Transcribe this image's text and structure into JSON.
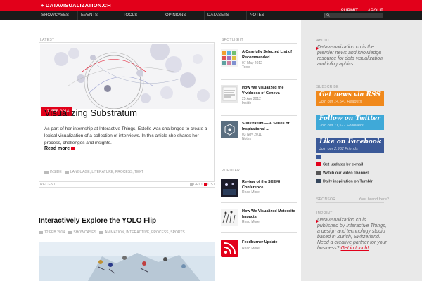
{
  "header": {
    "logo": "+ DATAVISUALIZATION.CH",
    "links": [
      "SUBMIT",
      "ABOUT"
    ]
  },
  "nav": {
    "items": [
      "SHOWCASES",
      "EVENTS",
      "TOOLS",
      "OPINIONS",
      "DATASETS",
      "NOTES"
    ]
  },
  "labels": {
    "latest": "LATEST",
    "spotlight": "SPOTLIGHT",
    "popular": "POPULAR",
    "recent": "RECENT",
    "about": "ABOUT",
    "subscribe": "SUBSCRIBE",
    "sponsor": "SPONSOR",
    "sponsor_link": "Your brand here?",
    "imprint": "IMPRINT"
  },
  "latest": {
    "date": "17 FEB 2014",
    "title": "Visualizing Substratum",
    "body": "As part of her internship at Interactive Things, Estelle was challenged to create a lexical visualization of a collection of interviews. In this article she shares her process, challenges and insights.",
    "read_more": "Read more",
    "category": "INSIDE",
    "tags": "LANGUAGE, LITERATURE, PROCESS, TEXT"
  },
  "spotlight": [
    {
      "title": "A Carefully Selected List of Recommended ...",
      "date": "07 May 2012",
      "category": "Tools"
    },
    {
      "title": "How We Visualized the Vividness of Geneva",
      "date": "25 Apr 2012",
      "category": "Inside"
    },
    {
      "title": "Substratum — A Series of Inspirational ...",
      "date": "03 Nov 2011",
      "category": "Notes"
    }
  ],
  "popular": [
    {
      "title": "Review of the SEE#8 Conference",
      "category": "Read More"
    },
    {
      "title": "How We Visualized Meteorite Impacts",
      "category": "Read More"
    },
    {
      "title": "Feedburner Update",
      "category": "Read More"
    }
  ],
  "recent": {
    "grid": "GRID",
    "list": "LIST",
    "title": "Interactively Explore the YOLO Flip",
    "date": "12 FEB 2014",
    "category": "SHOWCASES",
    "tags": "ANIMATION, INTERACTIVE, PROCESS, SPORTS"
  },
  "about": {
    "text": "Datavisualization.ch is the premier news and knowledge resource for data visualization and infographics."
  },
  "subscribe": {
    "rss_big": "Get news via RSS",
    "rss_small": "Join our 14,541 Readers",
    "tw_big": "Follow on Twitter",
    "tw_small": "Join our 11,577 Followers",
    "fb_big": "Like on Facebook",
    "fb_small": "Join our 2,962 Friends",
    "email": "Get updates by e-mail",
    "video": "Watch our video channel",
    "tumblr": "Daily inspiration on Tumblr"
  },
  "imprint": {
    "text": "Datavisualization.ch is published by Interactive Things, a design and technology studio based in Zürich, Switzerland. Need a creative partner for your business?",
    "link": "Get in touch!"
  },
  "colors": {
    "brand_red": "#e2001a",
    "nav_black": "#1a1a1a",
    "rss_orange": "#f0891c",
    "twitter_blue": "#3fa9d8",
    "facebook_blue": "#3b5998"
  }
}
